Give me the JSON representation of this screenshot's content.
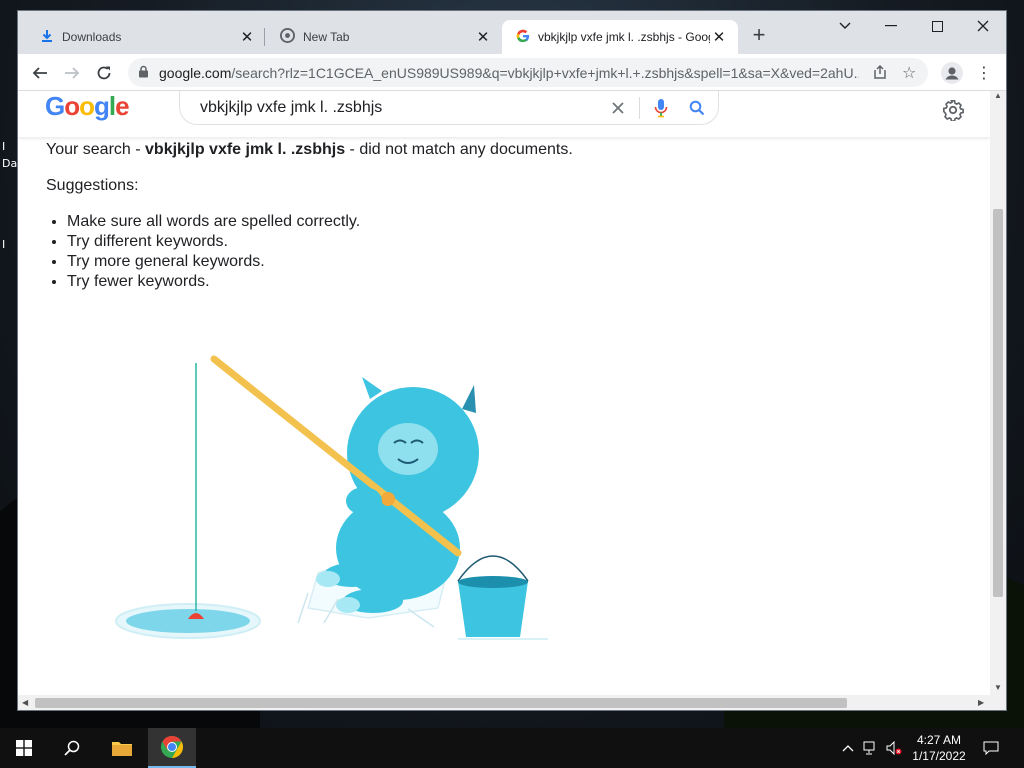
{
  "browser": {
    "tabs": [
      {
        "title": "Downloads",
        "icon": "download-icon"
      },
      {
        "title": "New Tab",
        "icon": "chrome-icon"
      },
      {
        "title": "vbkjkjlp vxfe jmk l. .zsbhjs - Goog",
        "icon": "google-icon"
      }
    ],
    "active_tab_index": 2,
    "url_host": "google.com",
    "url_rest": "/search?rlz=1C1GCEA_enUS989US989&q=vbkjkjlp+vxfe+jmk+l.+.zsbhjs&spell=1&sa=X&ved=2ahU..."
  },
  "search": {
    "query": "vbkjkjlp vxfe jmk l. .zsbhjs",
    "logo_text": "Google"
  },
  "results": {
    "prefix": "Your search - ",
    "query_bold": "vbkjkjlp vxfe jmk l. .zsbhjs",
    "suffix": " - did not match any documents.",
    "suggestions_title": "Suggestions:",
    "suggestions": [
      "Make sure all words are spelled correctly.",
      "Try different keywords.",
      "Try more general keywords.",
      "Try fewer keywords."
    ]
  },
  "desktop": {
    "label1": "I",
    "label2": "Da",
    "label3": "I"
  },
  "taskbar": {
    "time": "4:27 AM",
    "date": "1/17/2022"
  },
  "colors": {
    "google_blue": "#4285f4",
    "google_red": "#ea4335",
    "google_yellow": "#fbbc05",
    "google_green": "#34a853",
    "yeti": "#3cc4e0",
    "rod": "#f3c14e"
  }
}
